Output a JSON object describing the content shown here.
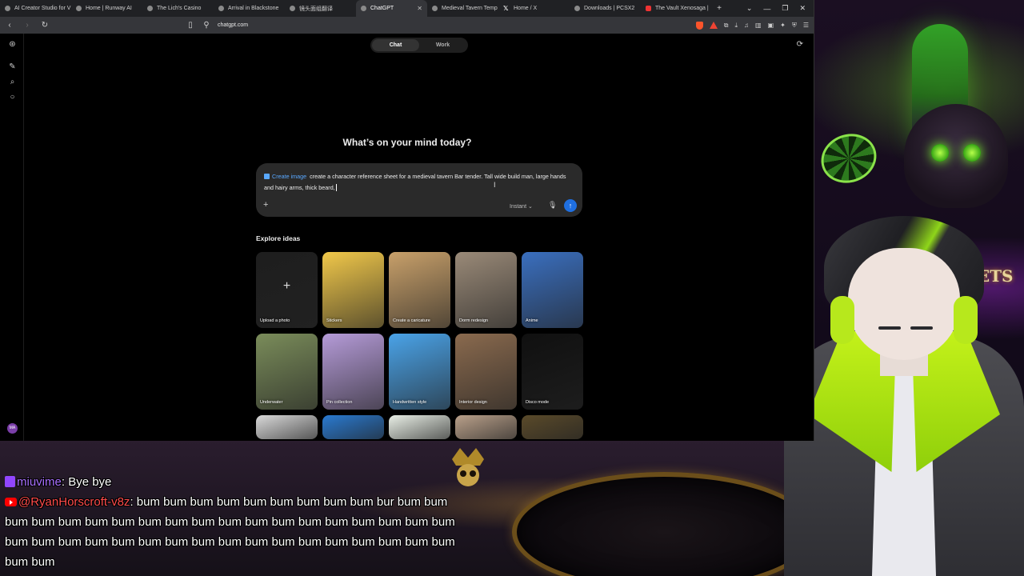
{
  "browser": {
    "tabs": [
      {
        "label": "AI Creator Studio for V",
        "favicon": "dot"
      },
      {
        "label": "Home | Runway AI",
        "favicon": "dot"
      },
      {
        "label": "The Lich's Casino",
        "favicon": "dot"
      },
      {
        "label": "Arrival in Blackstone",
        "favicon": "dot"
      },
      {
        "label": "镜头面组翻译",
        "favicon": "dot"
      },
      {
        "label": "ChatGPT",
        "favicon": "dot",
        "active": true
      },
      {
        "label": "Medieval Tavern Temp",
        "favicon": "dot"
      },
      {
        "label": "Home / X",
        "favicon": "x"
      },
      {
        "label": "Downloads | PCSX2",
        "favicon": "dot"
      },
      {
        "label": "The Vault Xenosaga |",
        "favicon": "yt"
      }
    ],
    "new_tab": "+",
    "url": "chatgpt.com",
    "window_controls": [
      "⌄",
      "—",
      "❐",
      "✕"
    ]
  },
  "chatgpt": {
    "modes": [
      {
        "label": "Chat",
        "active": true
      },
      {
        "label": "Work",
        "active": false
      }
    ],
    "headline": "What’s on your mind today?",
    "composer": {
      "chip_label": "Create image",
      "text": "create a character reference sheet for a medieval tavern Bar tender. Tall wide build man, large hands and hairy arms, thick beard,",
      "model_label": "Instant",
      "send_icon": "↑",
      "plus_icon": "+"
    },
    "explore_title": "Explore ideas",
    "ideas": [
      {
        "label": "Upload a photo",
        "color": "#1e1e1e"
      },
      {
        "label": "Stickers",
        "color": "#f1c84a"
      },
      {
        "label": "Create a caricature",
        "color": "#c8a06a"
      },
      {
        "label": "Dorm redesign",
        "color": "#9a8a78"
      },
      {
        "label": "Anime",
        "color": "#3a6fbf"
      },
      {
        "label": "Underwater",
        "color": "#7a8c5a"
      },
      {
        "label": "Pin collection",
        "color": "#b59bd8"
      },
      {
        "label": "Handwritten style",
        "color": "#4aa3e8"
      },
      {
        "label": "Interior design",
        "color": "#8a6a4e"
      },
      {
        "label": "Disco mode",
        "color": "#101010"
      },
      {
        "label": "",
        "color": "#d9d9d9"
      },
      {
        "label": "",
        "color": "#2a7ad0"
      },
      {
        "label": "",
        "color": "#e9efe6"
      },
      {
        "label": "",
        "color": "#b9a08a"
      },
      {
        "label": "",
        "color": "#5a4a2a"
      }
    ],
    "user_initials": "MA"
  },
  "stream": {
    "bets_sign": "BETS",
    "chat": [
      {
        "platform": "twitch",
        "user": "miuvime",
        "message": "Bye bye"
      },
      {
        "platform": "youtube",
        "user": "@RyanHorscroft-v8z",
        "message": "bum bum bum bum bum bum bum bum bum bur bum bum bum bum bum bum bum bum bum bum bum bum bum bum bum bum bum bum bum bum bum bum bum bum bum bum bum bum bum bum bum bum bum bum bum bum bum bum"
      }
    ]
  },
  "colors": {
    "accent_blue": "#1f6fe0",
    "link_blue": "#59a8ff",
    "twitch_purple": "#9146ff",
    "youtube_red": "#ff0000",
    "avatar_green": "#b7e81c"
  }
}
